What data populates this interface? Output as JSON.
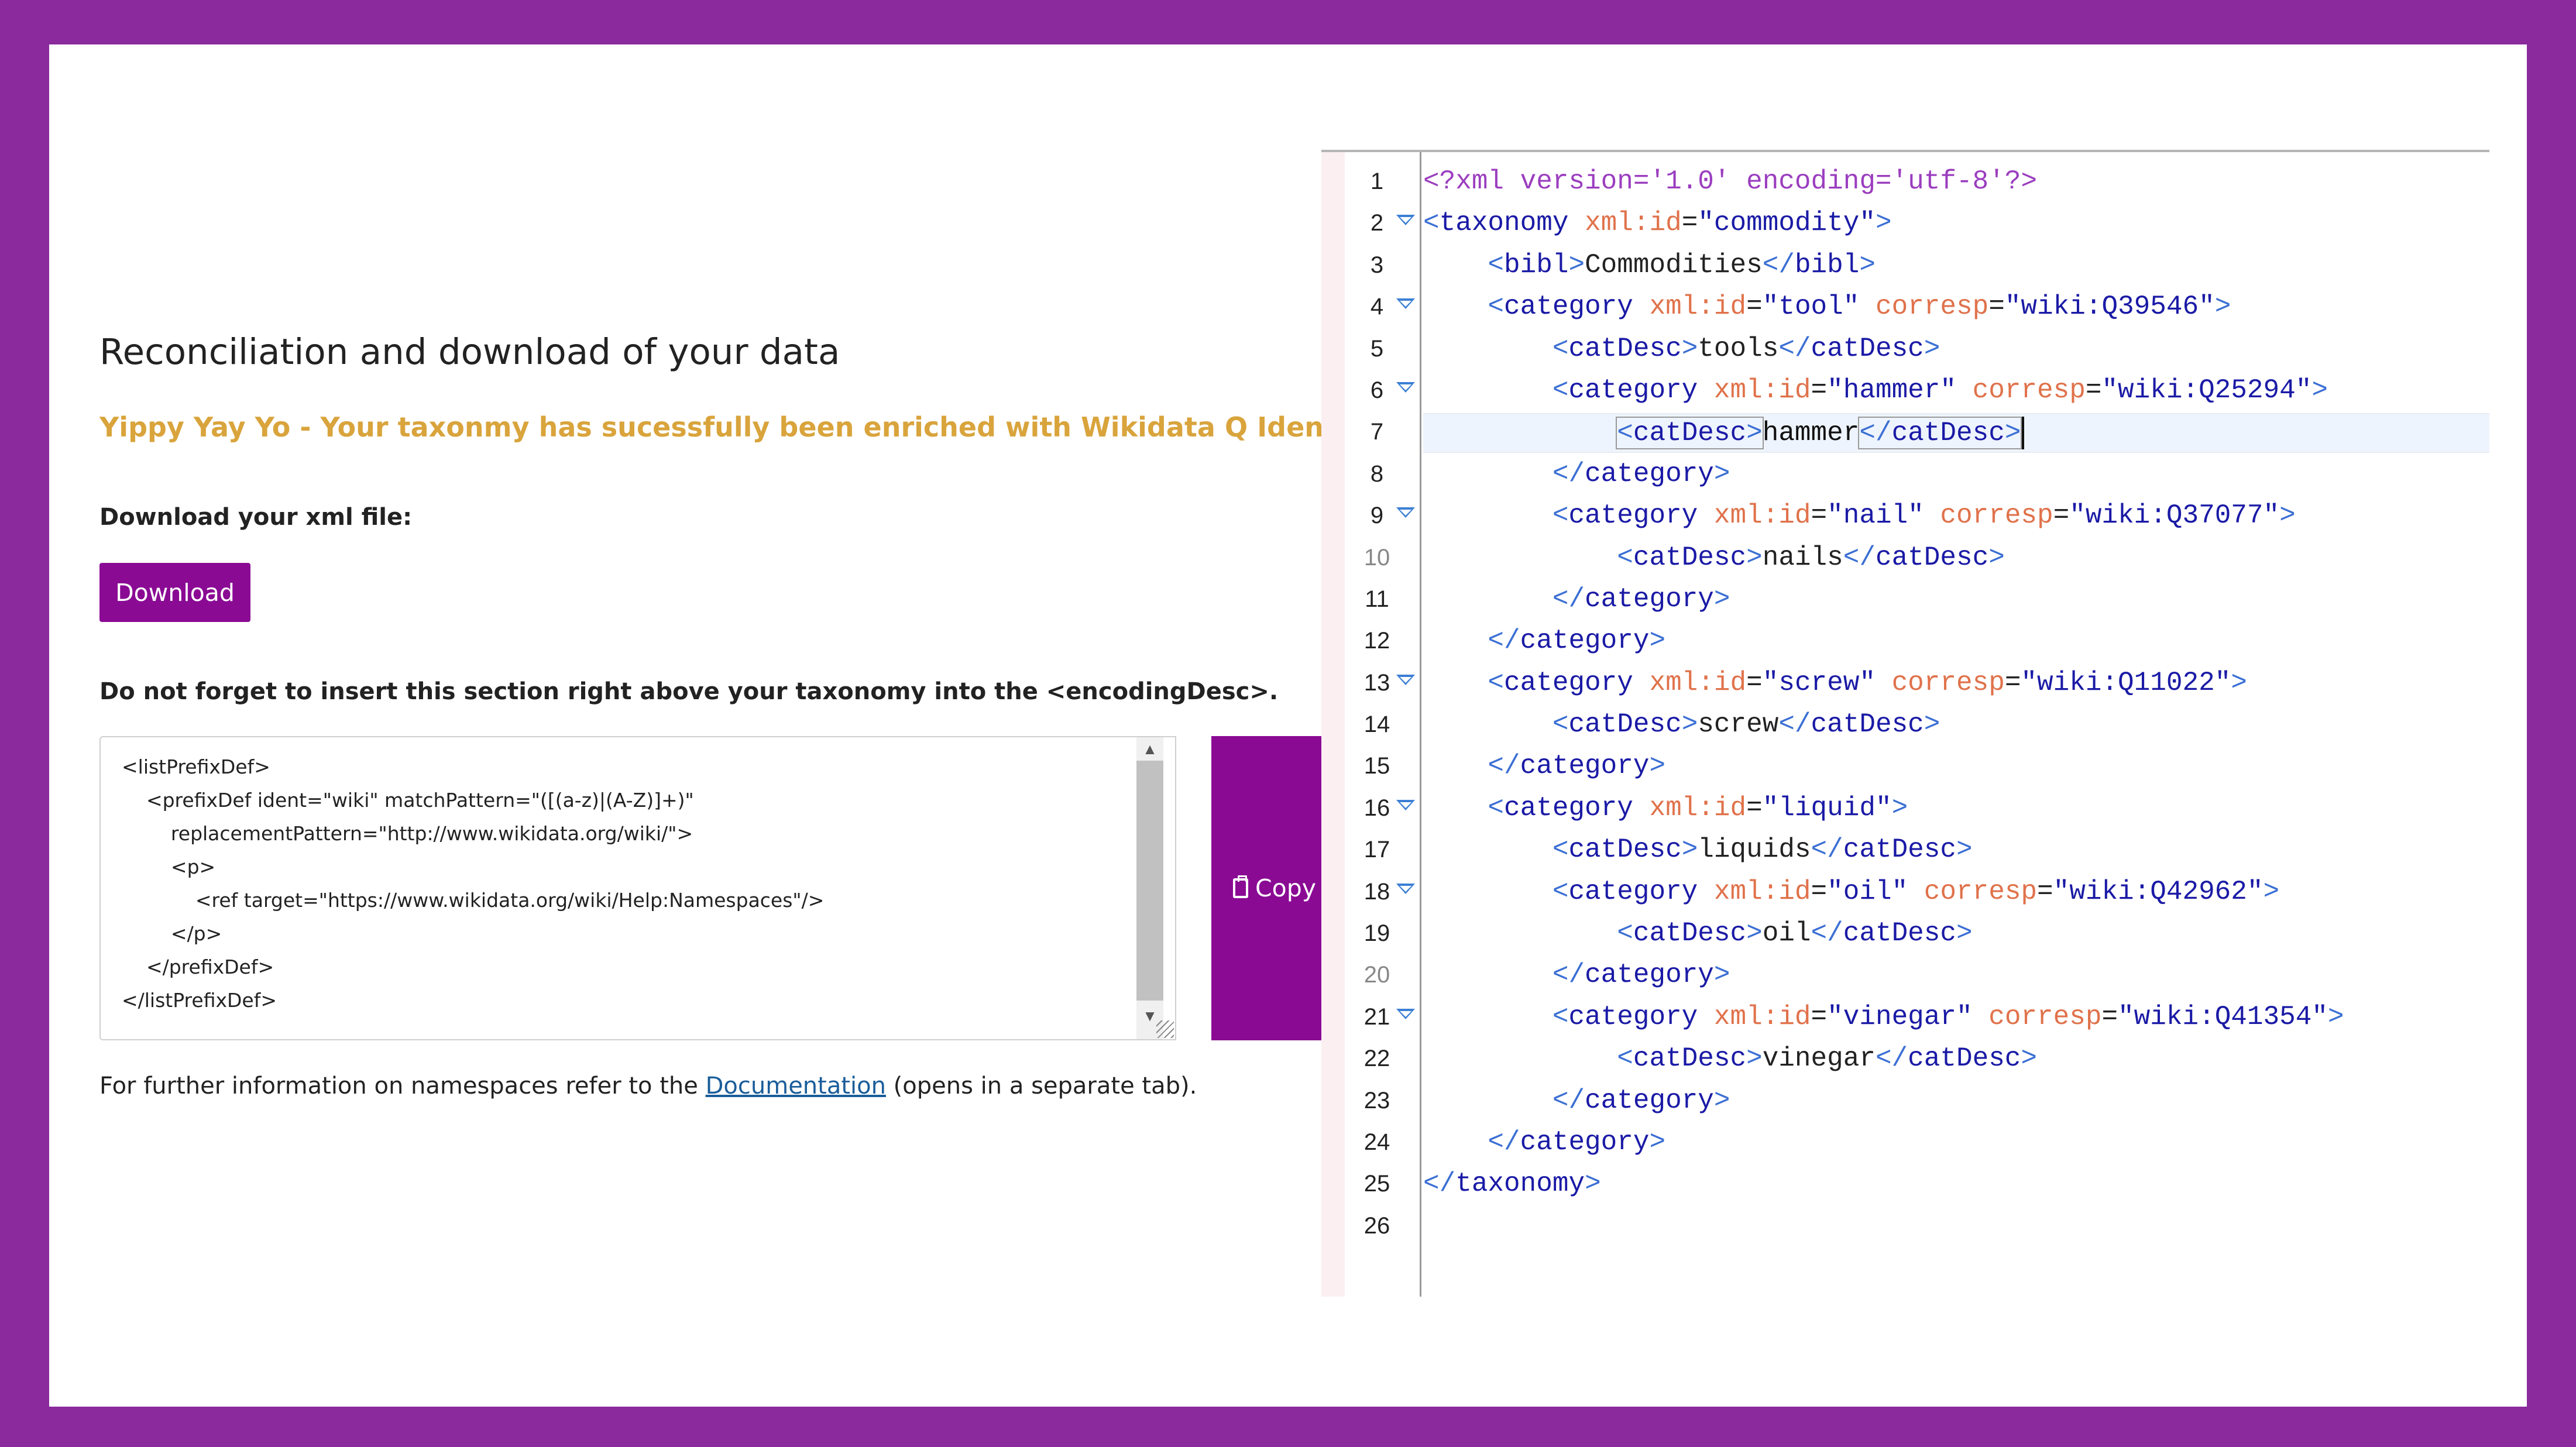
{
  "left": {
    "title": "Reconciliation and download of your data",
    "success_message": "Yippy Yay Yo - Your taxonmy has sucessfully been enriched with Wikidata Q Identifiers!",
    "download_label": "Download your xml file:",
    "download_button": "Download",
    "insert_note": "Do not forget to insert this section right above your taxonomy into the <encodingDesc>.",
    "code_snippet": "<listPrefixDef>\n    <prefixDef ident=\"wiki\" matchPattern=\"([(a-z)|(A-Z)]+)\"\n        replacementPattern=\"http://www.wikidata.org/wiki/\">\n        <p>\n            <ref target=\"https://www.wikidata.org/wiki/Help:Namespaces\"/>\n        </p>\n    </prefixDef>\n</listPrefixDef>",
    "copy_button": "Copy",
    "further_info_prefix": "For further information on namespaces refer to the ",
    "further_info_link": "Documentation",
    "further_info_suffix": " (opens in a separate tab)."
  },
  "editor": {
    "line_numbers": [
      "1",
      "2",
      "3",
      "4",
      "5",
      "6",
      "7",
      "8",
      "9",
      "10",
      "11",
      "12",
      "13",
      "14",
      "15",
      "16",
      "17",
      "18",
      "19",
      "20",
      "21",
      "22",
      "23",
      "24",
      "25",
      "26"
    ],
    "lines": [
      "<?xml version='1.0' encoding='utf-8'?>",
      "<taxonomy xml:id=\"commodity\">",
      "    <bibl>Commodities</bibl>",
      "    <category xml:id=\"tool\" corresp=\"wiki:Q39546\">",
      "        <catDesc>tools</catDesc>",
      "        <category xml:id=\"hammer\" corresp=\"wiki:Q25294\">",
      "            <catDesc>hammer</catDesc>",
      "        </category>",
      "        <category xml:id=\"nail\" corresp=\"wiki:Q37077\">",
      "            <catDesc>nails</catDesc>",
      "        </category>",
      "    </category>",
      "    <category xml:id=\"screw\" corresp=\"wiki:Q11022\">",
      "        <catDesc>screw</catDesc>",
      "    </category>",
      "    <category xml:id=\"liquid\">",
      "        <catDesc>liquids</catDesc>",
      "        <category xml:id=\"oil\" corresp=\"wiki:Q42962\">",
      "            <catDesc>oil</catDesc>",
      "        </category>",
      "        <category xml:id=\"vinegar\" corresp=\"wiki:Q41354\">",
      "            <catDesc>vinegar</catDesc>",
      "        </category>",
      "    </category>",
      "</taxonomy>",
      ""
    ]
  }
}
